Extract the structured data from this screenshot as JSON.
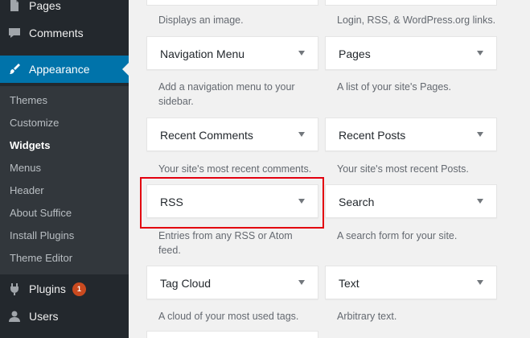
{
  "sidebar": {
    "pages_label": "Pages",
    "comments_label": "Comments",
    "appearance_label": "Appearance",
    "submenu": {
      "themes": "Themes",
      "customize": "Customize",
      "widgets": "Widgets",
      "menus": "Menus",
      "header": "Header",
      "about": "About Suffice",
      "install_plugins": "Install Plugins",
      "theme_editor": "Theme Editor"
    },
    "plugins_label": "Plugins",
    "plugins_badge": "1",
    "users_label": "Users",
    "icons": [
      "pages-icon",
      "comments-icon",
      "appearance-brush-icon",
      "plugins-icon",
      "users-icon"
    ]
  },
  "widgets": {
    "image_desc": "Displays an image.",
    "meta_desc": "Login, RSS, & WordPress.org links.",
    "navigation_menu": {
      "title": "Navigation Menu",
      "desc": "Add a navigation menu to your sidebar."
    },
    "pages": {
      "title": "Pages",
      "desc": "A list of your site's Pages."
    },
    "recent_comments": {
      "title": "Recent Comments",
      "desc": "Your site's most recent comments."
    },
    "recent_posts": {
      "title": "Recent Posts",
      "desc": "Your site's most recent Posts."
    },
    "rss": {
      "title": "RSS",
      "desc": "Entries from any RSS or Atom feed."
    },
    "search": {
      "title": "Search",
      "desc": "A search form for your site."
    },
    "tag_cloud": {
      "title": "Tag Cloud",
      "desc": "A cloud of your most used tags."
    },
    "text": {
      "title": "Text",
      "desc": "Arbitrary text."
    }
  },
  "colors": {
    "sidebar_bg": "#23282d",
    "submenu_bg": "#32373c",
    "active_blue": "#0073aa",
    "badge_orange": "#ca4a1f",
    "highlight_red": "#e3000f"
  }
}
